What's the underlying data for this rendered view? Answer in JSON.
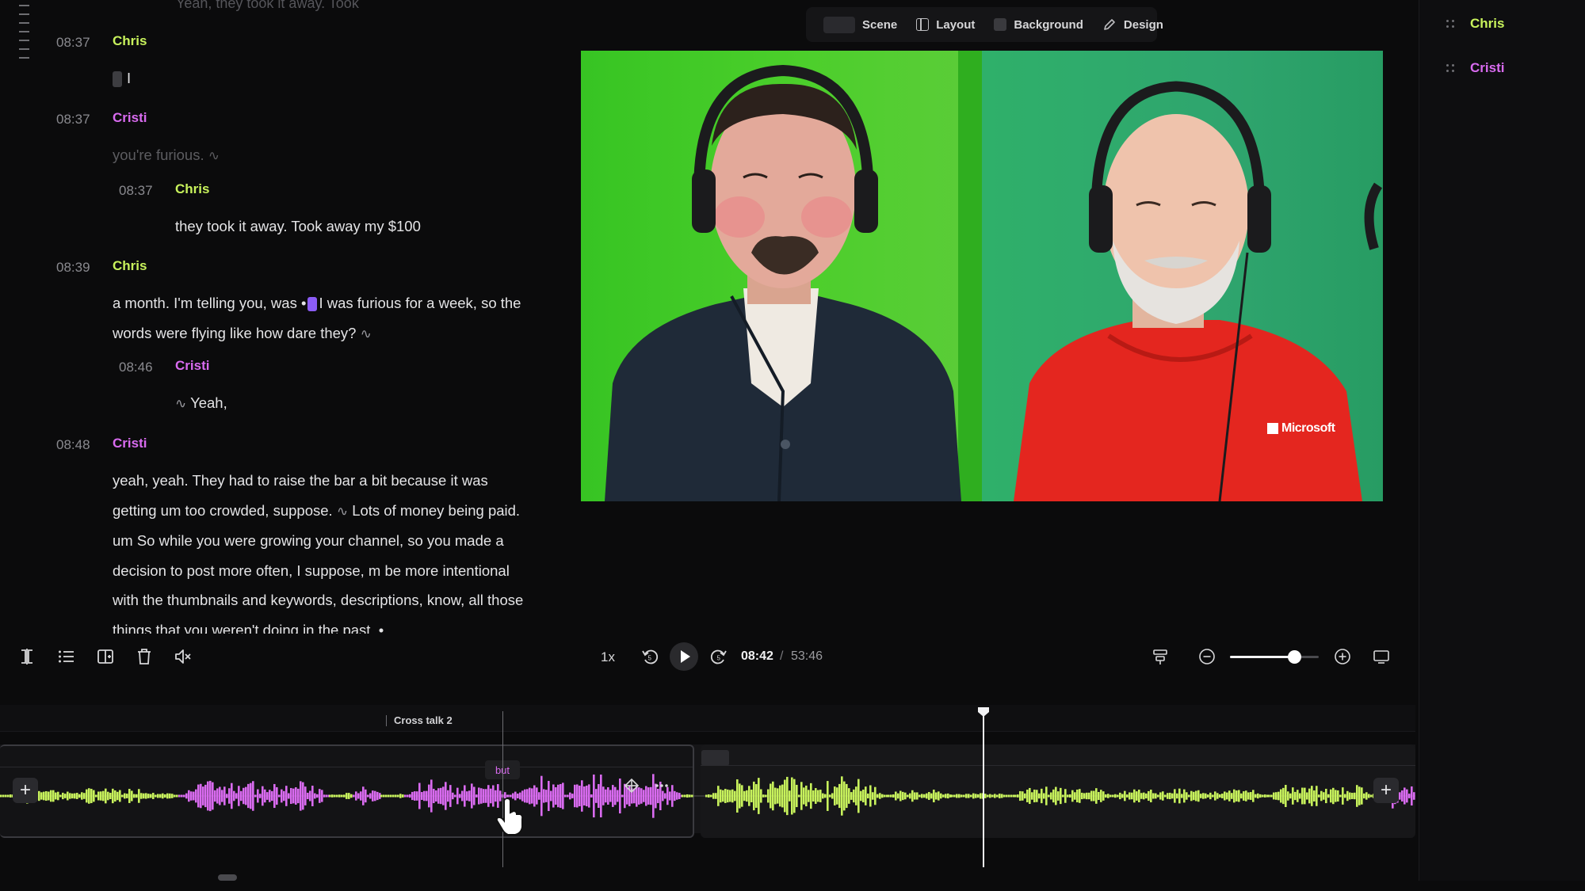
{
  "transcript": {
    "cut_text": "Yeah, they took it away. Took",
    "entries": [
      {
        "time": "08:37",
        "speaker": "Chris",
        "text": "I"
      },
      {
        "time": "08:37",
        "speaker": "Cristi",
        "text": "you're furious."
      },
      {
        "time": "08:37",
        "speaker": "Chris",
        "text": "they took it away. Took away my $100"
      },
      {
        "time": "08:39",
        "speaker": "Chris",
        "text_a": "a month. I'm telling you, was",
        "text_b": "I was furious for a week, so the words were flying like how dare they?"
      },
      {
        "time": "08:46",
        "speaker": "Cristi",
        "text": "Yeah,"
      },
      {
        "time": "08:48",
        "speaker": "Cristi",
        "text": "yeah, yeah. They had to raise the bar a bit because it was getting um too crowded, suppose.",
        "text_b": "Lots of money being paid. um So while you were growing your channel, so you made a decision to post more often, I suppose, m be more intentional with the thumbnails and keywords, descriptions, know, all those things that you weren't doing in the past. •"
      }
    ]
  },
  "video_toolbar": {
    "scene": "Scene",
    "layout": "Layout",
    "background": "Background",
    "design": "Design"
  },
  "video": {
    "shirt_logo": "Microsoft"
  },
  "speakers_panel": {
    "items": [
      {
        "name": "Chris",
        "color": "#c8f25c"
      },
      {
        "name": "Cristi",
        "color": "#d96bf0"
      }
    ]
  },
  "controls": {
    "speed": "1x",
    "current_time": "08:42",
    "separator": "/",
    "total_time": "53:46",
    "zoom_level": 0.72,
    "icons": [
      "split-icon",
      "list-icon",
      "insert-icon",
      "trash-icon",
      "mute-icon",
      "rewind-icon",
      "play-icon",
      "forward-icon",
      "align-icon",
      "zoom-out-icon",
      "zoom-in-icon",
      "screen-icon"
    ]
  },
  "timeline": {
    "marker": "Cross talk 2",
    "hover_word": "but"
  },
  "colors": {
    "chris": "#c8f25c",
    "cristi": "#d96bf0",
    "accent": "#8b5cf6"
  }
}
